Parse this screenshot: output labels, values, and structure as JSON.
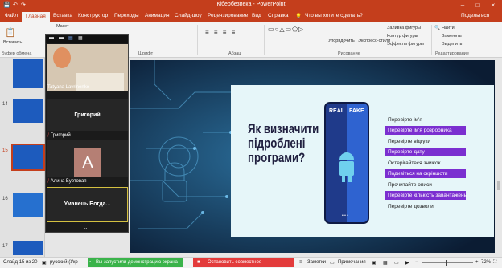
{
  "window": {
    "title": "Кібербезпека  -  PowerPoint",
    "user": "Подельться"
  },
  "tabs": [
    {
      "label": "Файл"
    },
    {
      "label": "Главная",
      "active": true
    },
    {
      "label": "Вставка"
    },
    {
      "label": "Конструктор"
    },
    {
      "label": "Переходы"
    },
    {
      "label": "Анимация"
    },
    {
      "label": "Слайд-шоу"
    },
    {
      "label": "Рецензирование"
    },
    {
      "label": "Вид"
    },
    {
      "label": "Справка"
    },
    {
      "label": "Что вы хотите сделать?"
    }
  ],
  "ribbon": {
    "paste": "Вставить",
    "clipboard": "Буфер обмена",
    "layout": "Макет",
    "font": "Шрифт",
    "paragraph": "Абзац",
    "arrange": "Упорядочить",
    "quick_styles": "Экспресс-стили",
    "fill": "Заливка фигуры",
    "outline": "Контур фигуры",
    "effects": "Эффекты фигуры",
    "drawing": "Рисование",
    "find": "Найти",
    "replace": "Заменить",
    "select": "Выделить",
    "editing": "Редактирование"
  },
  "thumbnails": [
    {
      "num": "14",
      "color": "#1d5bbd"
    },
    {
      "num": "15",
      "color": "#1d5bbd",
      "selected": true
    },
    {
      "num": "16",
      "color": "#2670cf"
    },
    {
      "num": "17",
      "color": "#1d5bbd"
    }
  ],
  "meeting": {
    "participants": [
      {
        "name": "Tatyana Lavrinenko",
        "has_video": true
      },
      {
        "display": "Григорий",
        "name": "Григорий"
      },
      {
        "avatar_letter": "А",
        "name": "Алина Буртовая"
      },
      {
        "display": "Уманець  Богда..."
      }
    ]
  },
  "slide": {
    "headline": "Як визначити\nпідроблені\nпрограми?",
    "phone_left": "REAL",
    "phone_right": "FAKE",
    "tips": [
      {
        "text": "Перевірте ім'я",
        "highlight": false
      },
      {
        "text": "Перевірте ім'я розробника",
        "highlight": true
      },
      {
        "text": "Перевірте відгуки",
        "highlight": false
      },
      {
        "text": "Перевірте дату",
        "highlight": true
      },
      {
        "text": "Остерігайтеся знижок",
        "highlight": false
      },
      {
        "text": "Подивіться на скріншоти",
        "highlight": true
      },
      {
        "text": "Прочитайте описи",
        "highlight": false
      },
      {
        "text": "Перевірте кількість завантажень",
        "highlight": true
      },
      {
        "text": "Перевірте дозволи",
        "highlight": false
      }
    ],
    "accent_color": "#7b2fd0"
  },
  "statusbar": {
    "slide_info": "Слайд 15 из 20",
    "language": "русский (Укр",
    "sharing": "Вы запустили демонстрацию экрана",
    "stop_sharing": "Остановить совместное использование",
    "notes": "Заметки",
    "comments": "Примечания",
    "zoom": "72%"
  }
}
